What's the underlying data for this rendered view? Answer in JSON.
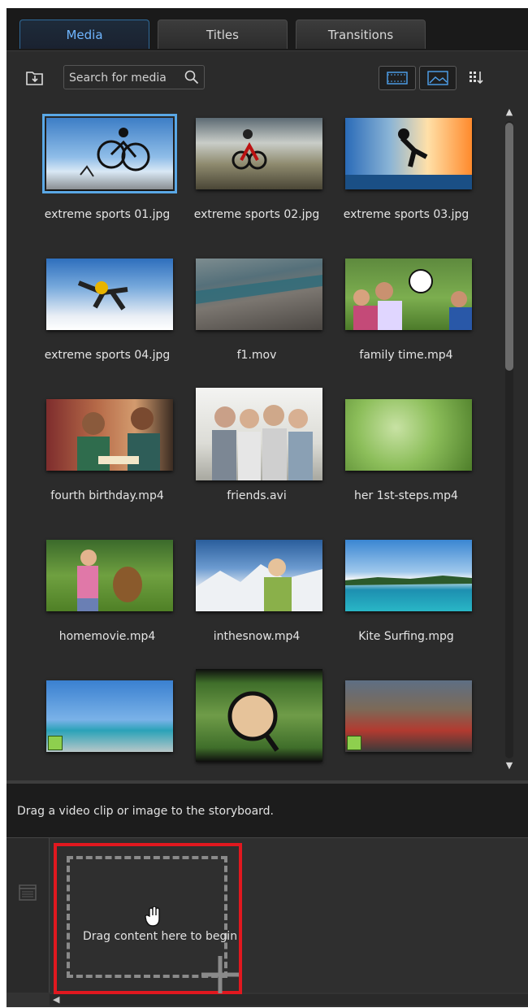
{
  "tabs": [
    {
      "label": "Media",
      "active": true
    },
    {
      "label": "Titles",
      "active": false
    },
    {
      "label": "Transitions",
      "active": false
    }
  ],
  "toolbar": {
    "import_icon": "import-media-icon",
    "search_placeholder": "Search for media",
    "search_icon": "magnifier-icon",
    "view_buttons": [
      "filmstrip-view-icon",
      "image-view-icon"
    ],
    "sort_icon": "sort-grid-icon"
  },
  "media": [
    {
      "name": "extreme sports 01.jpg",
      "type": "image",
      "selected": true
    },
    {
      "name": "extreme sports 02.jpg",
      "type": "image"
    },
    {
      "name": "extreme sports 03.jpg",
      "type": "image"
    },
    {
      "name": "extreme sports 04.jpg",
      "type": "image"
    },
    {
      "name": "f1.mov",
      "type": "video"
    },
    {
      "name": "family time.mp4",
      "type": "video"
    },
    {
      "name": "fourth birthday.mp4",
      "type": "video"
    },
    {
      "name": "friends.avi",
      "type": "video"
    },
    {
      "name": "her 1st-steps.mp4",
      "type": "video"
    },
    {
      "name": "homemovie.mp4",
      "type": "video"
    },
    {
      "name": "inthesnow.mp4",
      "type": "video"
    },
    {
      "name": "Kite Surfing.mpg",
      "type": "video"
    },
    {
      "name": "",
      "type": "video"
    },
    {
      "name": "",
      "type": "video"
    },
    {
      "name": "",
      "type": "video"
    }
  ],
  "hint_text": "Drag a video clip or image to the storyboard.",
  "storyboard": {
    "drop_text": "Drag content here to begin",
    "accent_color": "#e1181f"
  },
  "colors": {
    "active_tab": "#6fb6ff",
    "selection": "#5aa8e6",
    "highlight_box": "#e1181f"
  }
}
